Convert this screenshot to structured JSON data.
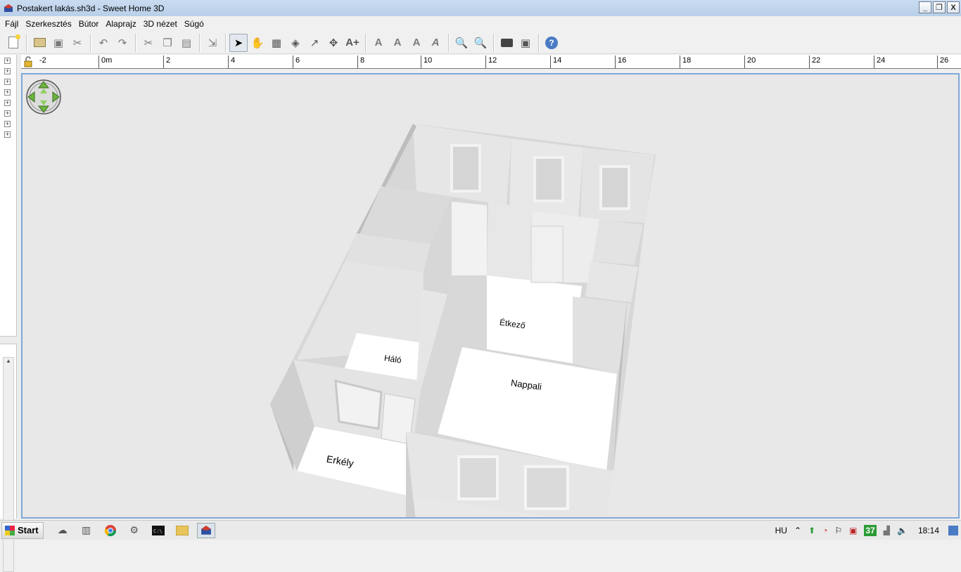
{
  "window": {
    "title": "Postakert lakás.sh3d - Sweet Home 3D",
    "minimize": "_",
    "restore": "❐",
    "close": "X"
  },
  "menu": [
    "Fájl",
    "Szerkesztés",
    "Bútor",
    "Alaprajz",
    "3D nézet",
    "Súgó"
  ],
  "ruler": {
    "labels": [
      "-2",
      "0m",
      "2",
      "4",
      "6",
      "8",
      "10",
      "12",
      "14",
      "16",
      "18",
      "20",
      "22",
      "24",
      "26"
    ]
  },
  "rooms": {
    "halo": "Háló",
    "etkezo": "Étkező",
    "nappali": "Nappali",
    "erkely": "Erkély"
  },
  "taskbar": {
    "start": "Start",
    "language": "HU",
    "badge": "37",
    "clock": "18:14"
  },
  "colors": {
    "titlebar": "#c4d8ef",
    "view_border": "#7fa7d8",
    "view_background": "#e8e8e8",
    "navigator_green": "#6db33f"
  }
}
